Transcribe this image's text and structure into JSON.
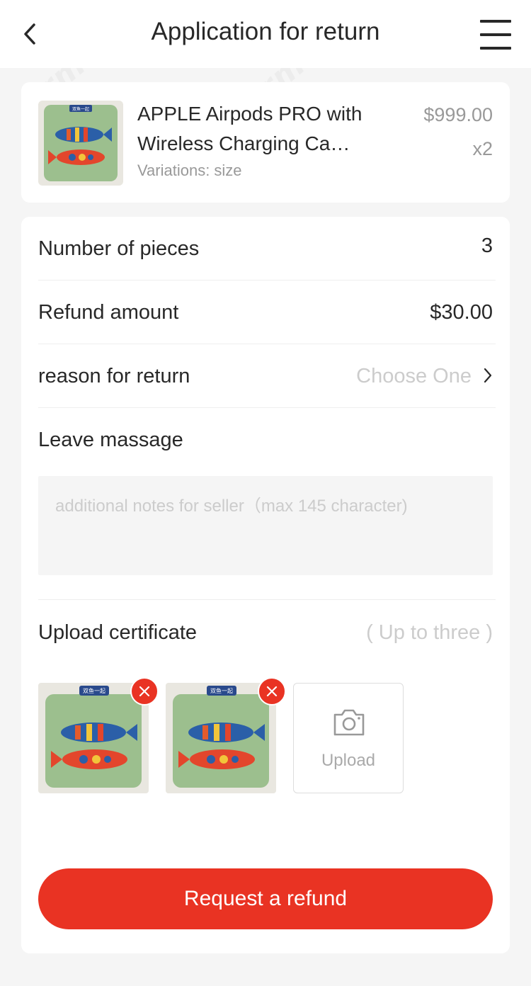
{
  "header": {
    "title": "Application for return",
    "back_icon": "chevron-left-icon",
    "menu_icon": "hamburger-menu-icon"
  },
  "product": {
    "name": "APPLE Airpods PRO with Wireless Charging Ca…",
    "variation": "Variations: size",
    "price": "$999.00",
    "quantity": "x2",
    "thumbnail_tag": "双鱼一起"
  },
  "form": {
    "pieces_label": "Number of pieces",
    "pieces_value": "3",
    "refund_label": "Refund amount",
    "refund_value": "$30.00",
    "reason_label": "reason for return",
    "reason_placeholder": "Choose One",
    "message_label": "Leave massage",
    "message_placeholder": "additional notes for seller（max 145 character)",
    "upload_label": "Upload certificate",
    "upload_hint": "( Up to three )",
    "upload_button": "Upload"
  },
  "uploaded_images": [
    {
      "tag": "双鱼一起"
    },
    {
      "tag": "双鱼一起"
    }
  ],
  "submit": {
    "label": "Request a refund"
  },
  "watermark": "crmeb",
  "colors": {
    "accent": "#e93323",
    "background": "#f5f5f5",
    "text": "#282828",
    "muted": "#999999",
    "placeholder": "#cccccc"
  }
}
